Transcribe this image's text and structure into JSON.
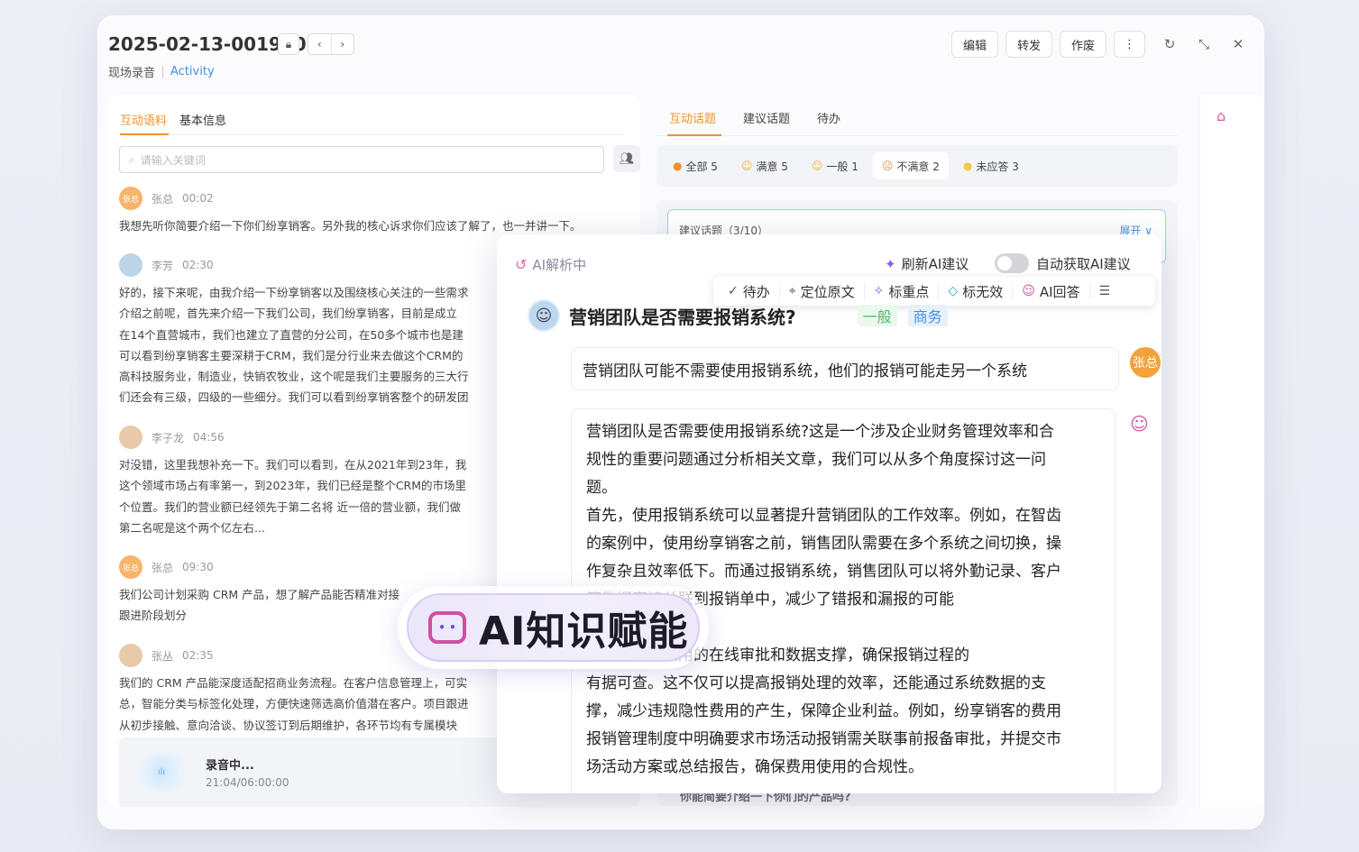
{
  "window": {
    "title": "2025-02-13-001960",
    "subtitle_left": "现场录音",
    "subtitle_right": "Activity",
    "actions": [
      "编辑",
      "转发",
      "作废"
    ],
    "more": "⋮"
  },
  "left": {
    "tabs": [
      "互动语料",
      "基本信息"
    ],
    "search_placeholder": "请输入关键词",
    "messages": [
      {
        "avatar": "张总",
        "name": "张总",
        "time": "00:02",
        "text": "我想先听你简要介绍一下你们纷享销客。另外我的核心诉求你们应该了解了，也一并讲一下。"
      },
      {
        "avatar": "",
        "name": "李芳",
        "time": "02:30",
        "text": "好的，接下来呢，由我介绍一下纷享销客以及围绕核心关注的一些需求\n介绍之前呢，首先来介绍一下我们公司，我们纷享销客，目前是成立\n在14个直营城市，我们也建立了直营的分公司，在50多个城市也是建\n可以看到纷享销客主要深耕于CRM，我们是分行业来去做这个CRM的\n高科技服务业，制造业，快销农牧业，这个呢是我们主要服务的三大行\n们还会有三级，四级的一些细分。我们可以看到纷享销客整个的研发团"
      },
      {
        "avatar": "",
        "name": "李子龙",
        "time": "04:56",
        "text": "对没错，这里我想补充一下。我们可以看到，在从2021年到23年，我\n这个领域市场占有率第一，到2023年，我们已经是整个CRM的市场里\n个位置。我们的营业额已经领先于第二名将 近一倍的营业额，我们做\n第二名呢是这个两个亿左右..."
      },
      {
        "avatar": "张总",
        "name": "张总",
        "time": "09:30",
        "text": "我们公司计划采购 CRM 产品，想了解产品能否精准对接\n跟进阶段划分"
      },
      {
        "avatar": "",
        "name": "张丛",
        "time": "02:35",
        "text": "我们的 CRM 产品能深度适配招商业务流程。在客户信息管理上，可实\n总，智能分类与标签化处理，方便快速筛选高价值潜在客户。项目跟进\n从初步接触、意向洽谈、协议签订到后期维护，各环节均有专属模块"
      }
    ],
    "recording": {
      "title": "录音中...",
      "elapsed": "21:04",
      "total": "/06:00:00",
      "wave_label": "ılı"
    }
  },
  "right": {
    "tabs": [
      "互动话题",
      "建议话题",
      "待办"
    ],
    "filters": [
      {
        "icon": "●",
        "label": "全部 5"
      },
      {
        "icon": "☺",
        "label": "满意 5"
      },
      {
        "icon": "☺",
        "label": "一般 1"
      },
      {
        "icon": "☹",
        "label": "不满意 2"
      },
      {
        "icon": "●",
        "label": "未应答 3"
      }
    ],
    "suggest_label": "建议话题（3/10）",
    "suggest_expand": "展开 ∨",
    "bottom_text": "你能简要介绍一下你们的产品吗?"
  },
  "ai": {
    "status": "AI解析中",
    "refresh": "刷新AI建议",
    "auto": "自动获取AI建议",
    "toolbar": [
      "待办",
      "定位原文",
      "标重点",
      "标无效",
      "AI回答"
    ],
    "question": "营销团队是否需要报销系统?",
    "tags": [
      "一般",
      "商务"
    ],
    "reply": "营销团队可能不需要使用报销系统，他们的报销可能走另一个系统",
    "reply_avatar": "张总",
    "answer": "营销团队是否需要使用报销系统?这是一个涉及企业财务管理效率和合\n规性的重要问题通过分析相关文章，我们可以从多个角度探讨这一问\n题。\n首先，使用报销系统可以显著提升营销团队的工作效率。例如，在智齿\n的案例中，使用纷享销客之前，销售团队需要在多个系统之间切换，操\n作复杂且效率低下。而通过报销系统，销售团队可以将外勤记录、客户\n等数据直接关联到报销单中，减少了错报和漏报的可能\n费用提报的效率。\n统能够实现费用的在线审批和数据支撑，确保报销过程的\n有据可查。这不仅可以提高报销处理的效率，还能通过系统数据的支\n撑，减少违规隐性费用的产生，保障企业利益。例如，纷享销客的费用\n报销管理制度中明确要求市场活动报销需关联事前报备审批，并提交市\n场活动方案或总结报告，确保费用使用的合规性。"
  },
  "badge": {
    "text": "AI知识赋能",
    "icon": "robot-icon"
  },
  "colors": {
    "accent": "#f0932b",
    "link": "#4a8fd8",
    "ai_pink": "#d04fa2",
    "ai_purple": "#8a5cf0"
  }
}
